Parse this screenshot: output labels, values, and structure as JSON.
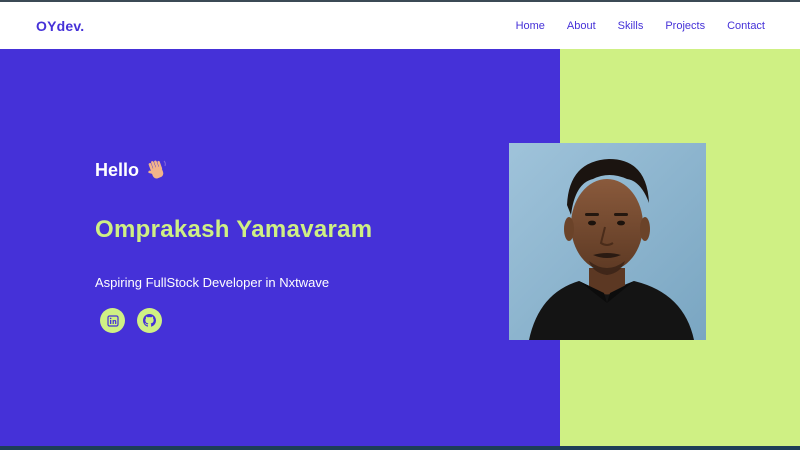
{
  "brand": {
    "logo": "OYdev."
  },
  "nav": {
    "items": [
      "Home",
      "About",
      "Skills",
      "Projects",
      "Contact"
    ]
  },
  "hero": {
    "greeting": "Hello",
    "name": "Omprakash Yamavaram",
    "role": "Aspiring FullStock Developer in Nxtwave"
  },
  "socials": [
    {
      "icon": "linkedin-icon"
    },
    {
      "icon": "github-icon"
    }
  ],
  "colors": {
    "primary": "#4531d8",
    "accent": "#cff084",
    "text_light": "#ffffff"
  }
}
